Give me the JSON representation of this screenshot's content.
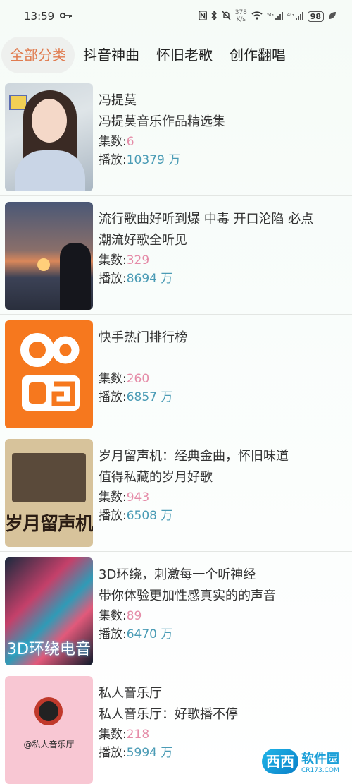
{
  "status_bar": {
    "time": "13:59",
    "key_icon": "key-icon",
    "speed_value": "378",
    "speed_unit": "K/s",
    "signal_label_1": "5G",
    "signal_label_2": "4G",
    "battery": "98"
  },
  "tabs": [
    {
      "label": "全部分类",
      "active": true
    },
    {
      "label": "抖音神曲"
    },
    {
      "label": "怀旧老歌"
    },
    {
      "label": "创作翻唱"
    }
  ],
  "list": [
    {
      "title": "冯提莫",
      "subtitle": "冯提莫音乐作品精选集",
      "count_label": "集数:",
      "count": "6",
      "play_label": "播放:",
      "play": "10379 万"
    },
    {
      "title": "流行歌曲好听到爆 中毒 开口沦陷 必点",
      "subtitle": "潮流好歌全听见",
      "count_label": "集数:",
      "count": "329",
      "play_label": "播放:",
      "play": "8694 万"
    },
    {
      "title": "快手热门排行榜",
      "subtitle": "",
      "count_label": "集数:",
      "count": "260",
      "play_label": "播放:",
      "play": "6857 万"
    },
    {
      "title": "岁月留声机：经典金曲，怀旧味道",
      "subtitle": "值得私藏的岁月好歌",
      "count_label": "集数:",
      "count": "943",
      "play_label": "播放:",
      "play": "6508 万",
      "cover_text": "岁月留声机"
    },
    {
      "title": "3D环绕，刺激每一个听神经",
      "subtitle": "带你体验更加性感真实的的声音",
      "count_label": "集数:",
      "count": "89",
      "play_label": "播放:",
      "play": "6470 万",
      "cover_text": "3D环绕电音"
    },
    {
      "title": "私人音乐厅",
      "subtitle": "私人音乐厅：好歌播不停",
      "count_label": "集数:",
      "count": "218",
      "play_label": "播放:",
      "play": "5994 万",
      "cover_text": "@私人音乐厅"
    }
  ],
  "watermark": {
    "logo": "西西",
    "title": "软件园",
    "url": "CR173.COM"
  },
  "colors": {
    "active_tab": "#e07b4f",
    "count": "#e58ca8",
    "play": "#4a9bb5"
  }
}
